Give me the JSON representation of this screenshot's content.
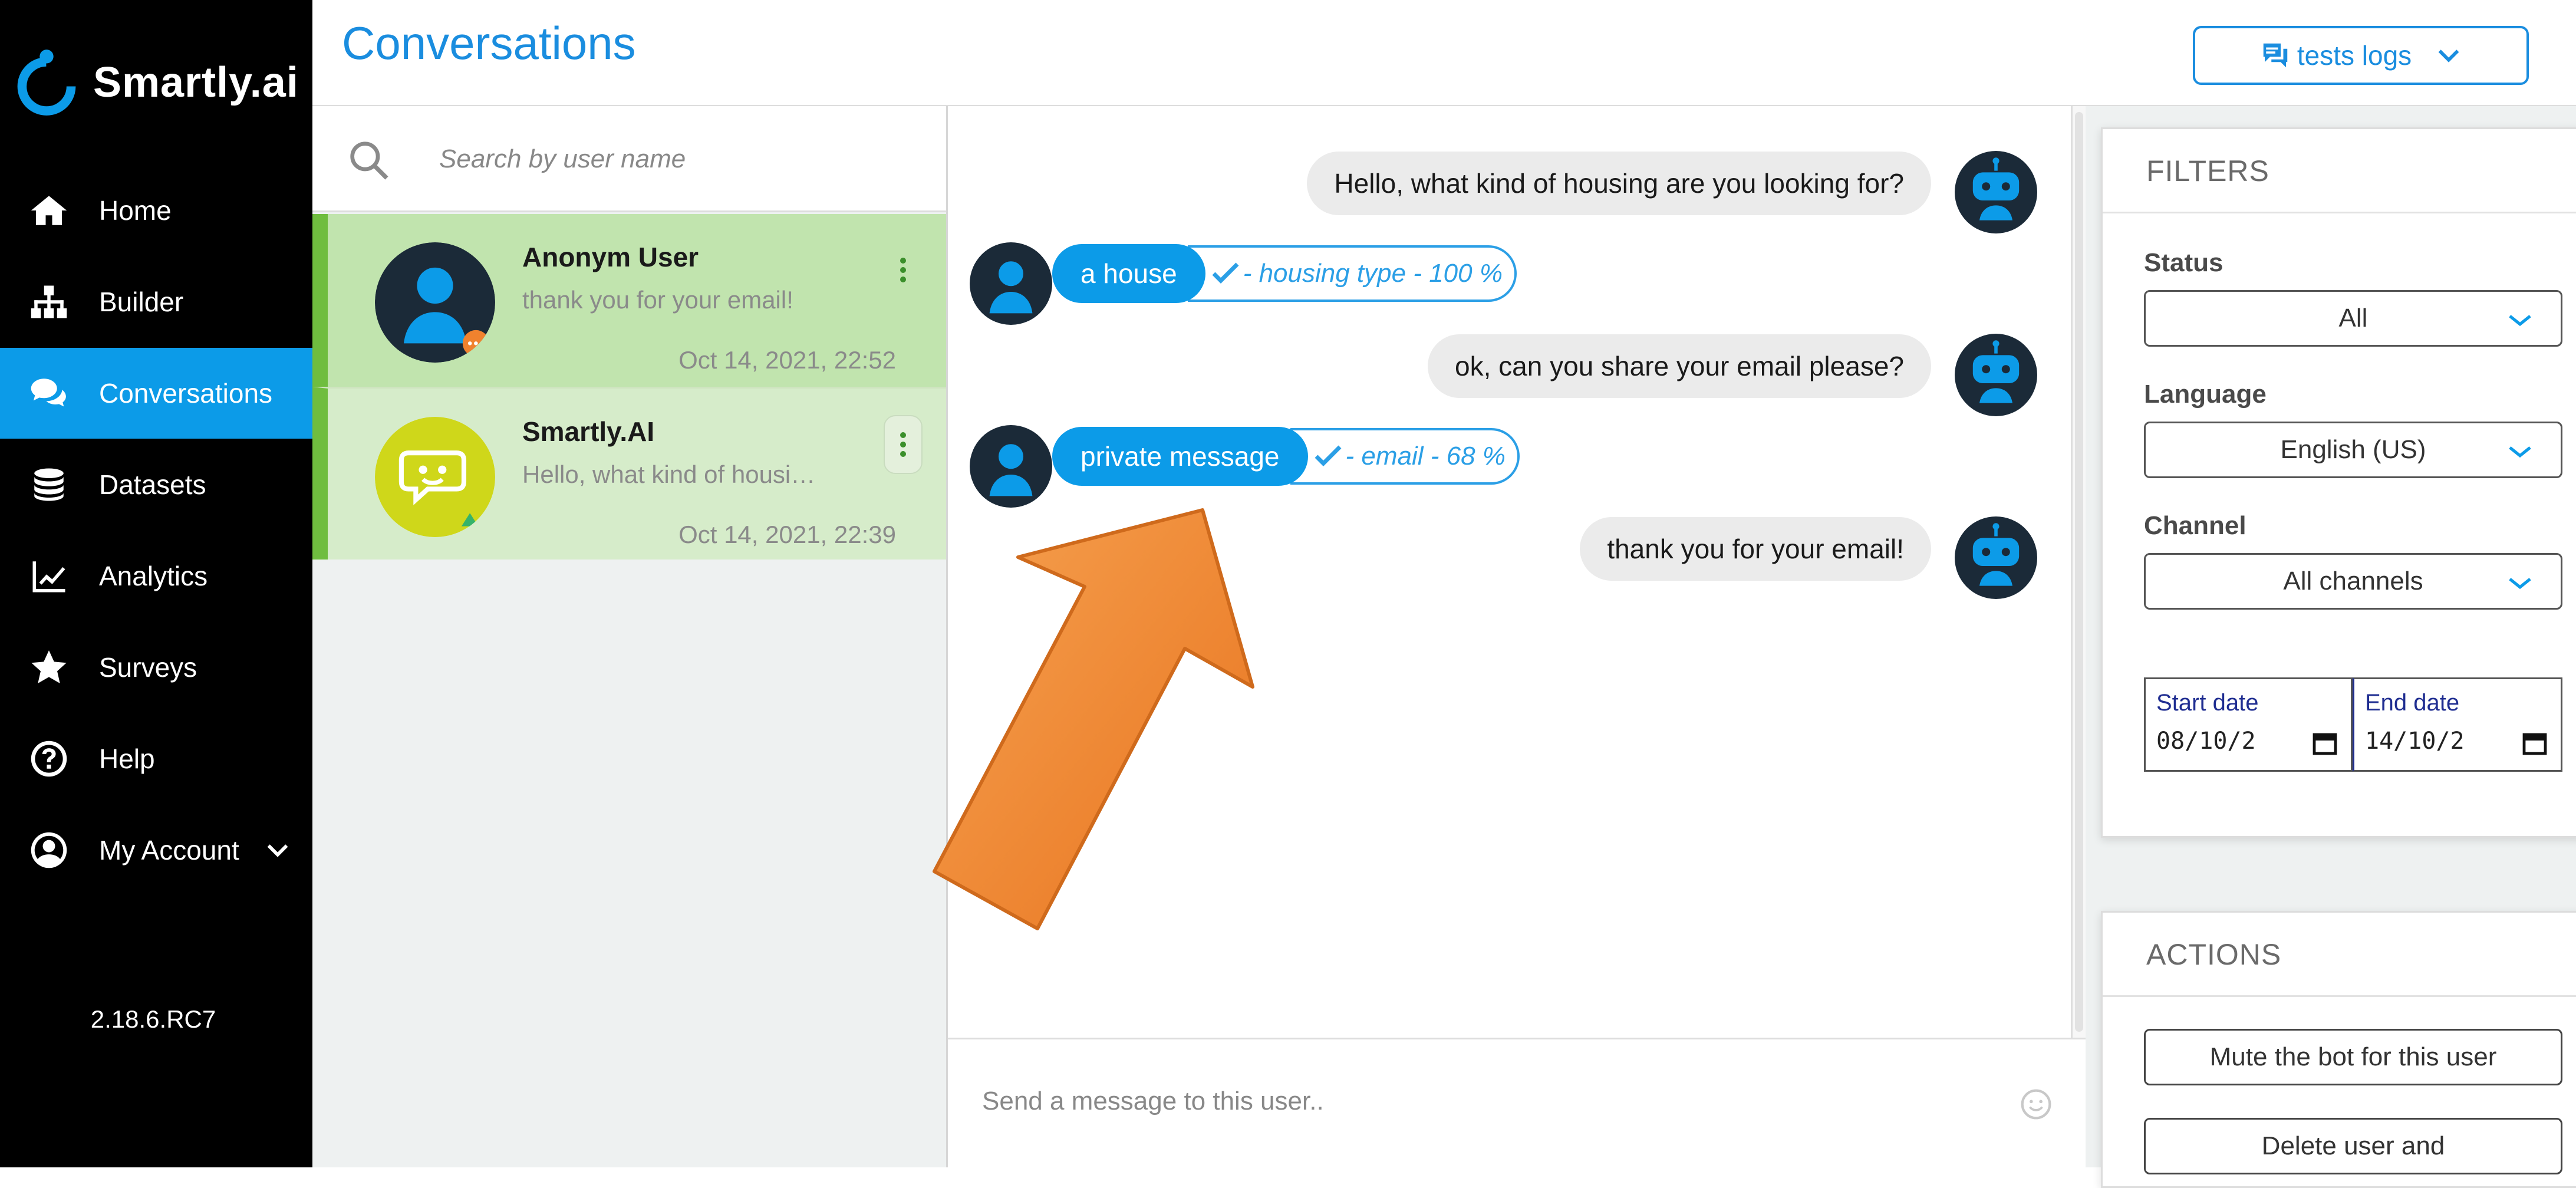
{
  "app": {
    "brand_name": "Smartly.ai",
    "version": "2.18.6.RC7"
  },
  "sidebar": {
    "items": [
      {
        "label": "Home",
        "icon": "home-icon"
      },
      {
        "label": "Builder",
        "icon": "sitemap-icon"
      },
      {
        "label": "Conversations",
        "icon": "chat-bubbles-icon",
        "active": true
      },
      {
        "label": "Datasets",
        "icon": "database-icon"
      },
      {
        "label": "Analytics",
        "icon": "line-chart-icon"
      },
      {
        "label": "Surveys",
        "icon": "star-icon"
      },
      {
        "label": "Help",
        "icon": "question-circle-icon"
      },
      {
        "label": "My Account",
        "icon": "user-circle-icon",
        "has_dropdown": true
      }
    ]
  },
  "header": {
    "title": "Conversations",
    "logs_select": "tests logs"
  },
  "conversation_list": {
    "search_placeholder": "Search by user name",
    "items": [
      {
        "name": "Anonym User",
        "preview": "thank you for your email!",
        "timestamp": "Oct 14, 2021, 22:52"
      },
      {
        "name": "Smartly.AI",
        "preview": "Hello, what kind of housing are you looking for?",
        "timestamp": "Oct 14, 2021, 22:39"
      }
    ]
  },
  "chat": {
    "messages": [
      {
        "from": "bot",
        "text": "Hello, what kind of housing are you looking for?"
      },
      {
        "from": "user",
        "text": "a house",
        "intent": "- housing type - 100 %"
      },
      {
        "from": "bot",
        "text": "ok, can you share your email please?"
      },
      {
        "from": "user",
        "text": "private message",
        "intent": "- email - 68 %"
      },
      {
        "from": "bot",
        "text": "thank you for your email!"
      }
    ],
    "composer_placeholder": "Send a message to this user.."
  },
  "filters": {
    "title": "FILTERS",
    "status_label": "Status",
    "status_value": "All",
    "language_label": "Language",
    "language_value": "English (US)",
    "channel_label": "Channel",
    "channel_value": "All channels",
    "start_date_label": "Start date",
    "start_date_value": "08/10/2",
    "end_date_label": "End date",
    "end_date_value": "14/10/2"
  },
  "actions": {
    "title": "ACTIONS",
    "mute_button": "Mute the bot for this user",
    "delete_button": "Delete user and"
  },
  "colors": {
    "accent": "#0c9be8",
    "title_blue": "#1a8ddf",
    "conv_selected": "#c1e4ae",
    "conv_item": "#d6ecca",
    "annotation_arrow": "#f07f2a"
  }
}
